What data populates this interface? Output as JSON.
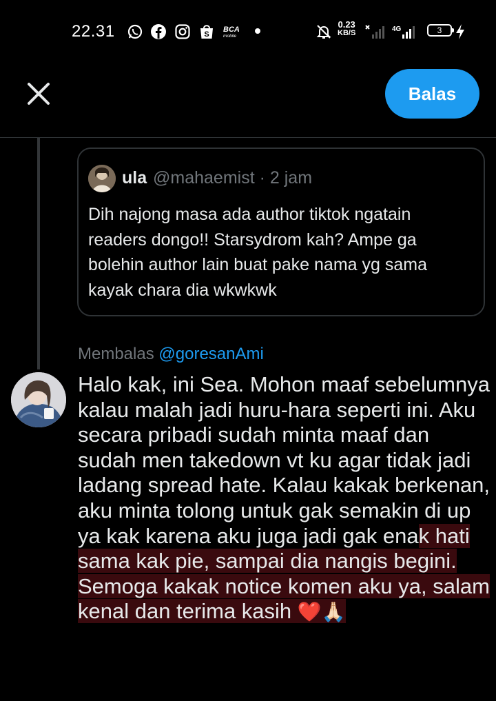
{
  "status_bar": {
    "time": "22.31",
    "net_speed_value": "0.23",
    "net_speed_unit": "KB/S",
    "network_type": "4G",
    "battery_level": "3",
    "notification_icons": [
      "whatsapp-icon",
      "facebook-icon",
      "instagram-icon",
      "shopee-icon",
      "bca-mobile-icon"
    ],
    "bca_label": "BCA",
    "bca_sublabel": "mobile"
  },
  "header": {
    "close_icon": "close-icon",
    "reply_button_label": "Balas",
    "accent_color": "#1d9bf0"
  },
  "quoted_tweet": {
    "display_name": "ula",
    "handle": "@mahaemist",
    "separator": "·",
    "time": "2 jam",
    "text": "Dih najong masa ada author tiktok ngatain readers dongo!! Starsydrom kah? Ampe ga bolehin author lain buat pake nama yg sama kayak chara dia wkwkwk"
  },
  "reply": {
    "replying_to_label": "Membalas",
    "replying_to_handle": "@goresanAmi",
    "text_plain": "Halo kak, ini Sea. Mohon maaf sebelumnya kalau malah jadi huru-hara seperti ini. Aku secara pribadi sudah minta maaf dan sudah men takedown vt ku agar tidak jadi ladang spread hate. Kalau kakak berkenan, aku minta tolong untuk gak semakin di up ya kak karena aku juga jadi gak ena",
    "text_highlighted": "k hati sama kak pie, sampai dia nangis begini. Semoga kakak notice komen aku ya, salam kenal dan terima kasih ",
    "emoji_heart": "❤️",
    "emoji_pray": "🙏🏻",
    "highlight_color": "#3a0a0e"
  }
}
